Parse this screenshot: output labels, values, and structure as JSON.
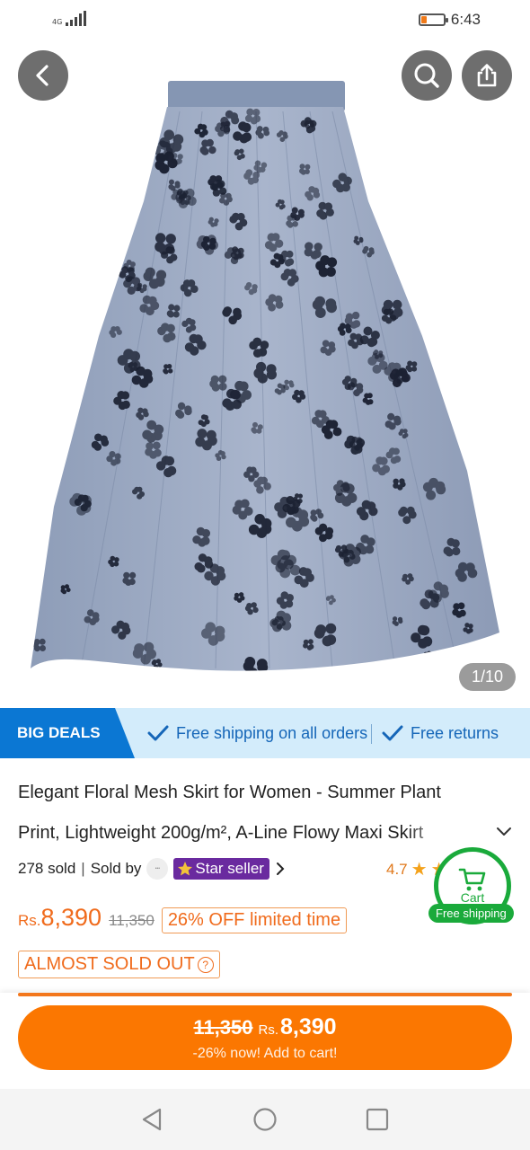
{
  "status_bar": {
    "network": "4G",
    "time": "6:43",
    "battery_level": 0.25,
    "battery_color": "#f07a1a"
  },
  "gallery": {
    "counter": "1/10"
  },
  "deals": {
    "badge": "BIG DEALS",
    "items": [
      "Free shipping on all orders",
      "Free returns"
    ],
    "colors": {
      "bar_bg": "#d3ecfb",
      "badge_bg": "#0b77d3",
      "text": "#1566b8"
    }
  },
  "product": {
    "title_line1": "Elegant Floral Mesh Skirt for Women - Summer Plant",
    "title_line2": "Print, Lightweight 200g/m², A-Line Flowy Maxi Skirt",
    "sold": "278 sold",
    "sold_by": "Sold by",
    "seller_badge": "Star seller",
    "rating": "4.7"
  },
  "cart_float": {
    "label": "Cart",
    "free_shipping": "Free shipping",
    "color": "#1aaa3b"
  },
  "price": {
    "currency": "Rs.",
    "current": "8,390",
    "original": "11,350",
    "discount_badge": "26% OFF limited time",
    "stock_badge": "ALMOST SOLD OUT",
    "accent_color": "#f06b1c"
  },
  "add_to_cart": {
    "old_price": "11,350",
    "currency": "Rs.",
    "new_price": "8,390",
    "subtitle": "-26% now! Add to cart!",
    "color": "#fb7701"
  },
  "nav": {
    "icons": [
      "back-triangle-icon",
      "home-circle-icon",
      "recents-square-icon"
    ]
  }
}
